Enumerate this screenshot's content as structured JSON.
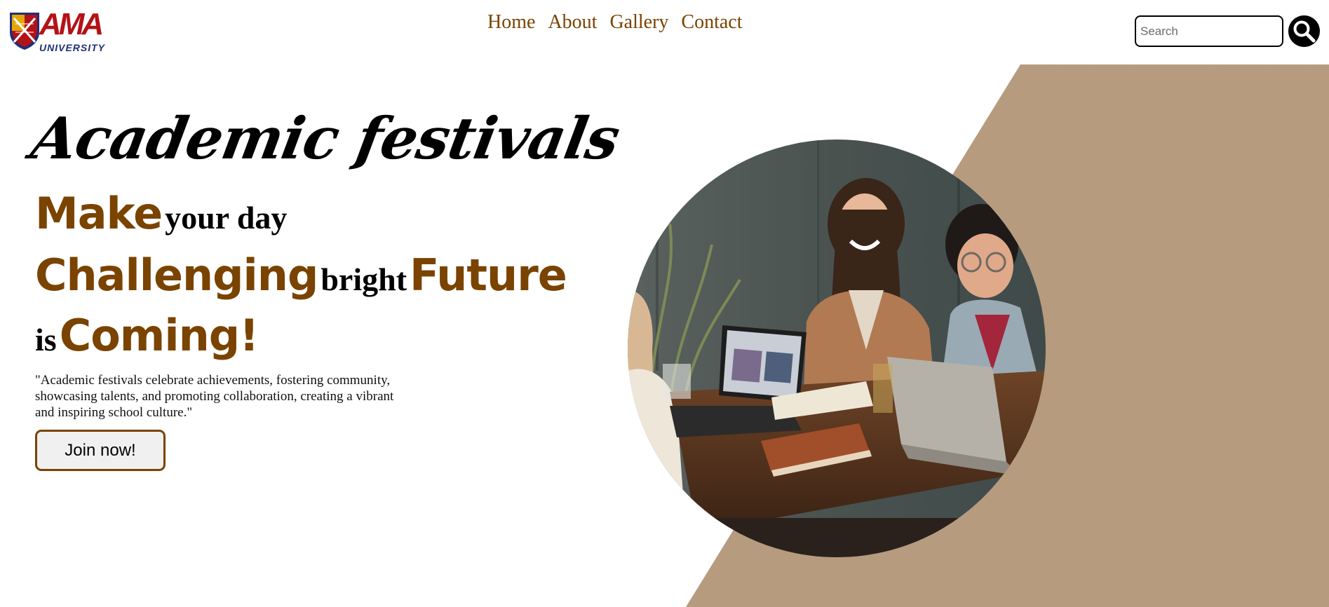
{
  "logo": {
    "brand": "AMA",
    "sub": "UNIVERSITY"
  },
  "nav": {
    "items": [
      {
        "label": "Home"
      },
      {
        "label": "About"
      },
      {
        "label": "Gallery"
      },
      {
        "label": "Contact"
      }
    ]
  },
  "search": {
    "placeholder": "Search"
  },
  "hero": {
    "script_title": "Academic festivals",
    "line1": {
      "hl": "Make",
      "plain": "your day"
    },
    "line2": {
      "hl1": "Challenging",
      "plain": "bright",
      "hl2": "Future"
    },
    "line3": {
      "plain": "is",
      "hl": "Coming!"
    },
    "description": "\"Academic festivals celebrate achievements, fostering community, showcasing talents, and promoting collaboration, creating a vibrant and inspiring school culture.\"",
    "cta": "Join now!"
  },
  "colors": {
    "accent": "#7a4300",
    "kraft": "#b89a7c",
    "logo_red": "#b31217",
    "logo_blue": "#1f2f7a"
  },
  "icons": {
    "search_button": "search-icon"
  }
}
